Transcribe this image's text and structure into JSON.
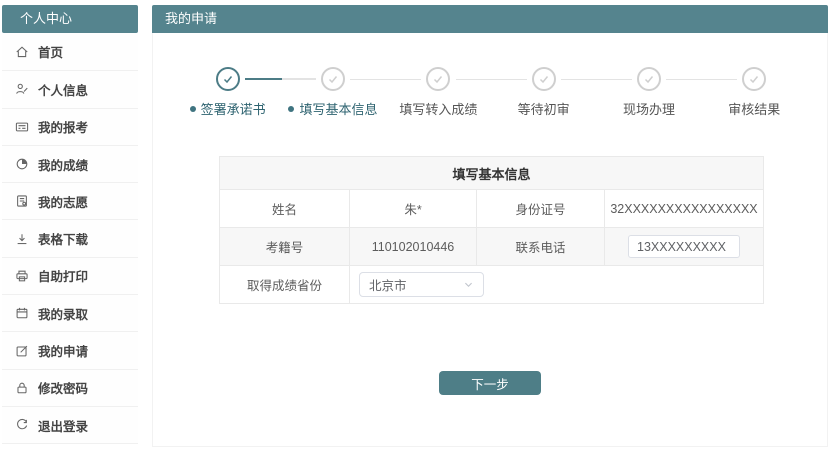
{
  "colors": {
    "accent_teal": "#55848E",
    "button_teal": "#4E7E87",
    "step_done_teal": "#4C7C86",
    "step_active_label": "#2E6370",
    "table_stripe": "#F7F7F7",
    "border_gray": "#E9E9E9"
  },
  "sidebar": {
    "title": "个人中心",
    "items": [
      {
        "icon": "home-icon",
        "label": "首页"
      },
      {
        "icon": "user-icon",
        "label": "个人信息"
      },
      {
        "icon": "card-icon",
        "label": "我的报考"
      },
      {
        "icon": "pie-icon",
        "label": "我的成绩"
      },
      {
        "icon": "document-icon",
        "label": "我的志愿"
      },
      {
        "icon": "download-icon",
        "label": "表格下载"
      },
      {
        "icon": "printer-icon",
        "label": "自助打印"
      },
      {
        "icon": "calendar-icon",
        "label": "我的录取"
      },
      {
        "icon": "edit-icon",
        "label": "我的申请"
      },
      {
        "icon": "lock-icon",
        "label": "修改密码"
      },
      {
        "icon": "logout-icon",
        "label": "退出登录"
      }
    ]
  },
  "main": {
    "title": "我的申请",
    "steps": [
      {
        "label": "签署承诺书",
        "state": "done",
        "bullet": true
      },
      {
        "label": "填写基本信息",
        "state": "current",
        "bullet": true
      },
      {
        "label": "填写转入成绩",
        "state": "pending",
        "bullet": false
      },
      {
        "label": "等待初审",
        "state": "pending",
        "bullet": false
      },
      {
        "label": "现场办理",
        "state": "pending",
        "bullet": false
      },
      {
        "label": "审核结果",
        "state": "pending",
        "bullet": false
      }
    ],
    "form": {
      "title": "填写基本信息",
      "name_label": "姓名",
      "name_value": "朱*",
      "id_label": "身份证号",
      "id_value": "32XXXXXXXXXXXXXXXX",
      "exam_no_label": "考籍号",
      "exam_no_value": "110102010446",
      "phone_label": "联系电话",
      "phone_value": "13XXXXXXXXX",
      "province_label": "取得成绩省份",
      "province_value": "北京市"
    },
    "next_button_label": "下一步"
  }
}
